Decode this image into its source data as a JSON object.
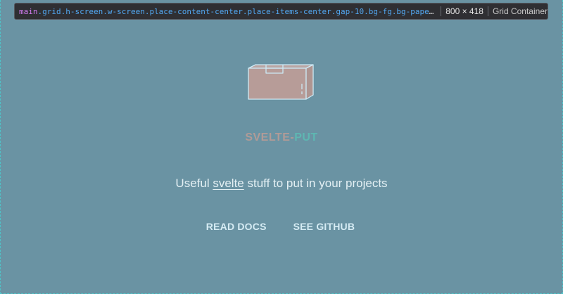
{
  "inspector": {
    "tag": "main",
    "classes": ".grid.h-screen.w-screen.place-content-center.place-items-center.gap-10.bg-fg.bg-paper.text-center.text-...",
    "dimensions": "800 × 418",
    "node_type": "Grid Container"
  },
  "brand": {
    "part1": "SVELTE-",
    "part2": "PUT"
  },
  "tagline": {
    "before": "Useful ",
    "link": "svelte",
    "after": " stuff to put in your projects"
  },
  "actions": {
    "docs": "READ DOCS",
    "github": "SEE GITHUB"
  },
  "colors": {
    "background": "#6a93a3",
    "box_fill": "#b79c98",
    "box_stroke": "#cdeaf6",
    "brand_part1": "#b19b97",
    "brand_part2": "#5eb7b2"
  },
  "icons": {
    "logo": "box-icon"
  }
}
